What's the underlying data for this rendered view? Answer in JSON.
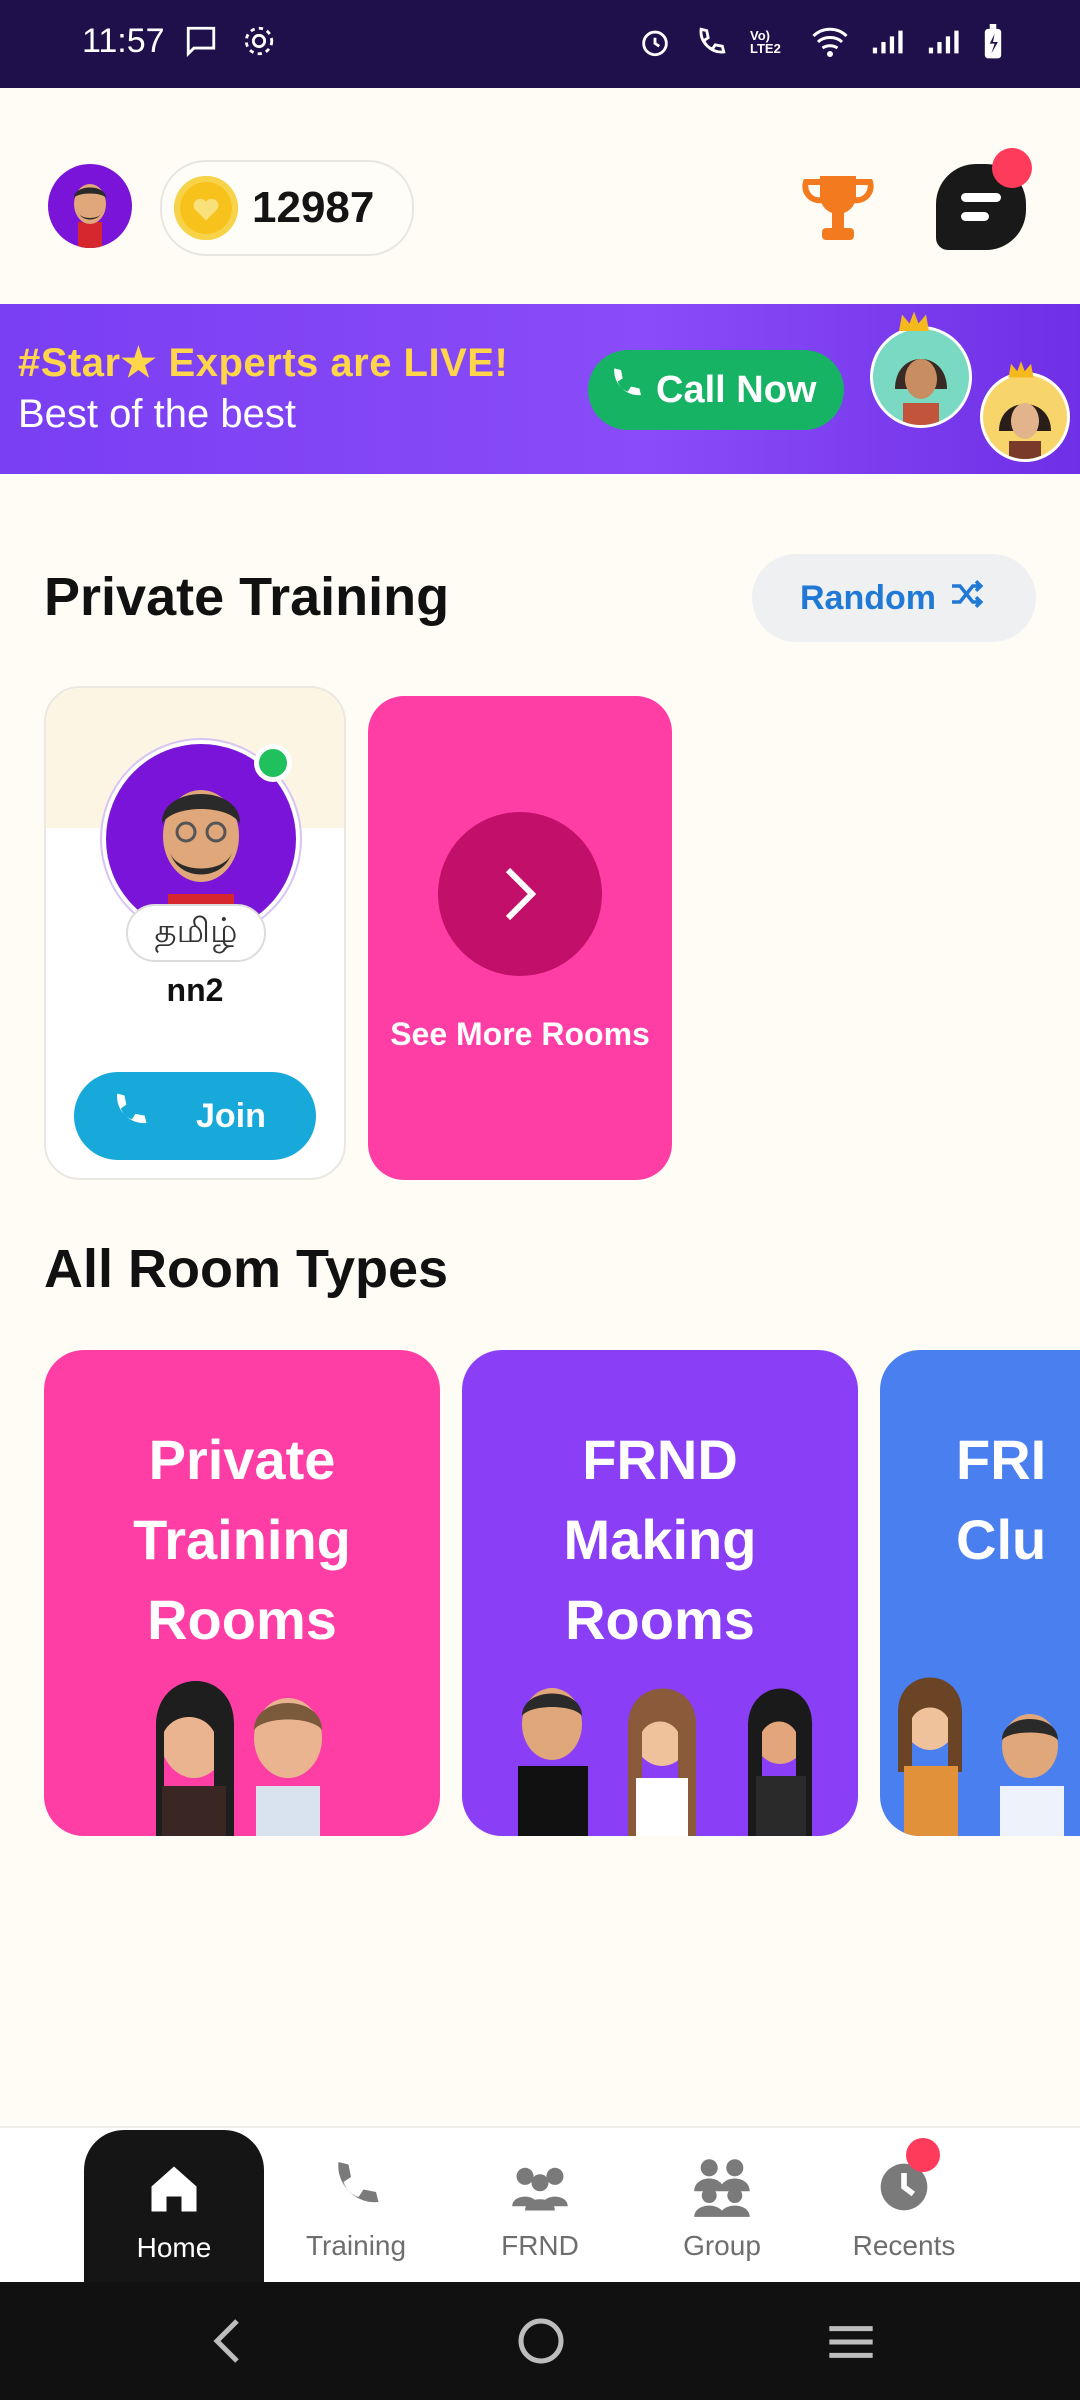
{
  "status_bar": {
    "time": "11:57",
    "left_icons": [
      "message-icon",
      "gear-icon"
    ],
    "right_icons": [
      "alarm-icon",
      "wifi-call-icon",
      "volte-icon",
      "wifi-icon",
      "signal-icon",
      "signal-icon",
      "battery-charging-icon"
    ],
    "volte_label": "Vo) LTE2"
  },
  "header": {
    "coins": "12987",
    "icons": [
      "avatar",
      "coin-icon",
      "trophy-icon",
      "chat-menu-icon"
    ]
  },
  "banner": {
    "title": "#Star★ Experts are LIVE!",
    "subtitle": "Best of the best",
    "cta": "Call Now"
  },
  "private_training": {
    "title": "Private Training",
    "random_label": "Random",
    "trainer": {
      "language": "தமிழ்",
      "name": "nn2",
      "join_label": "Join"
    },
    "see_more_label": "See More Rooms"
  },
  "room_types": {
    "title": "All Room Types",
    "cards": [
      {
        "title": "Private Training Rooms",
        "color": "#ff3ea5"
      },
      {
        "title": "FRND Making Rooms",
        "color": "#8a3ef5"
      },
      {
        "title": "FRI Clu",
        "color": "#4a7ff0"
      }
    ]
  },
  "bottom_nav": {
    "items": [
      {
        "label": "Home",
        "icon": "home-icon",
        "active": true
      },
      {
        "label": "Training",
        "icon": "phone-icon",
        "active": false
      },
      {
        "label": "FRND",
        "icon": "friends-icon",
        "active": false
      },
      {
        "label": "Group",
        "icon": "group-icon",
        "active": false
      },
      {
        "label": "Recents",
        "icon": "clock-icon",
        "active": false
      }
    ]
  },
  "colors": {
    "status_bar": "#1f0f4a",
    "banner": "#7a3ef3",
    "accent_pink": "#ff3ea5",
    "accent_green": "#16b364",
    "accent_blue": "#2179d6"
  }
}
